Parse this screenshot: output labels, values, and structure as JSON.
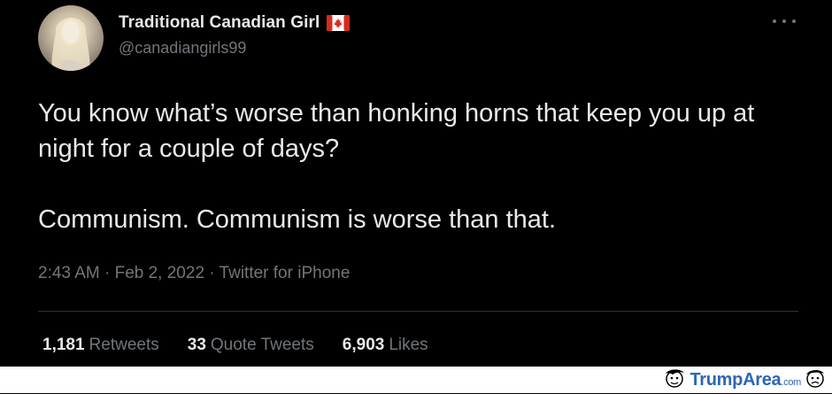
{
  "tweet": {
    "display_name": "Traditional Canadian Girl",
    "handle": "@canadiangirls99",
    "flag_icon": "canada-flag-icon",
    "more_icon": "more-options-icon",
    "text_line1": "You know what’s worse than honking horns that keep you up at night for a couple of days?",
    "text_line2": "Communism. Communism is worse than that.",
    "meta": "2:43 AM · Feb 2, 2022 · Twitter for iPhone",
    "stats": [
      {
        "count": "1,181",
        "label": "Retweets"
      },
      {
        "count": "33",
        "label": "Quote Tweets"
      },
      {
        "count": "6,903",
        "label": "Likes"
      }
    ]
  },
  "colors": {
    "background": "#000000",
    "primary_text": "#e7e9ea",
    "secondary_text": "#71767b",
    "divider": "#2f3336",
    "flag_red": "#d52b1e"
  },
  "watermark": {
    "brand": "TrumpArea",
    "domain": ".com"
  }
}
